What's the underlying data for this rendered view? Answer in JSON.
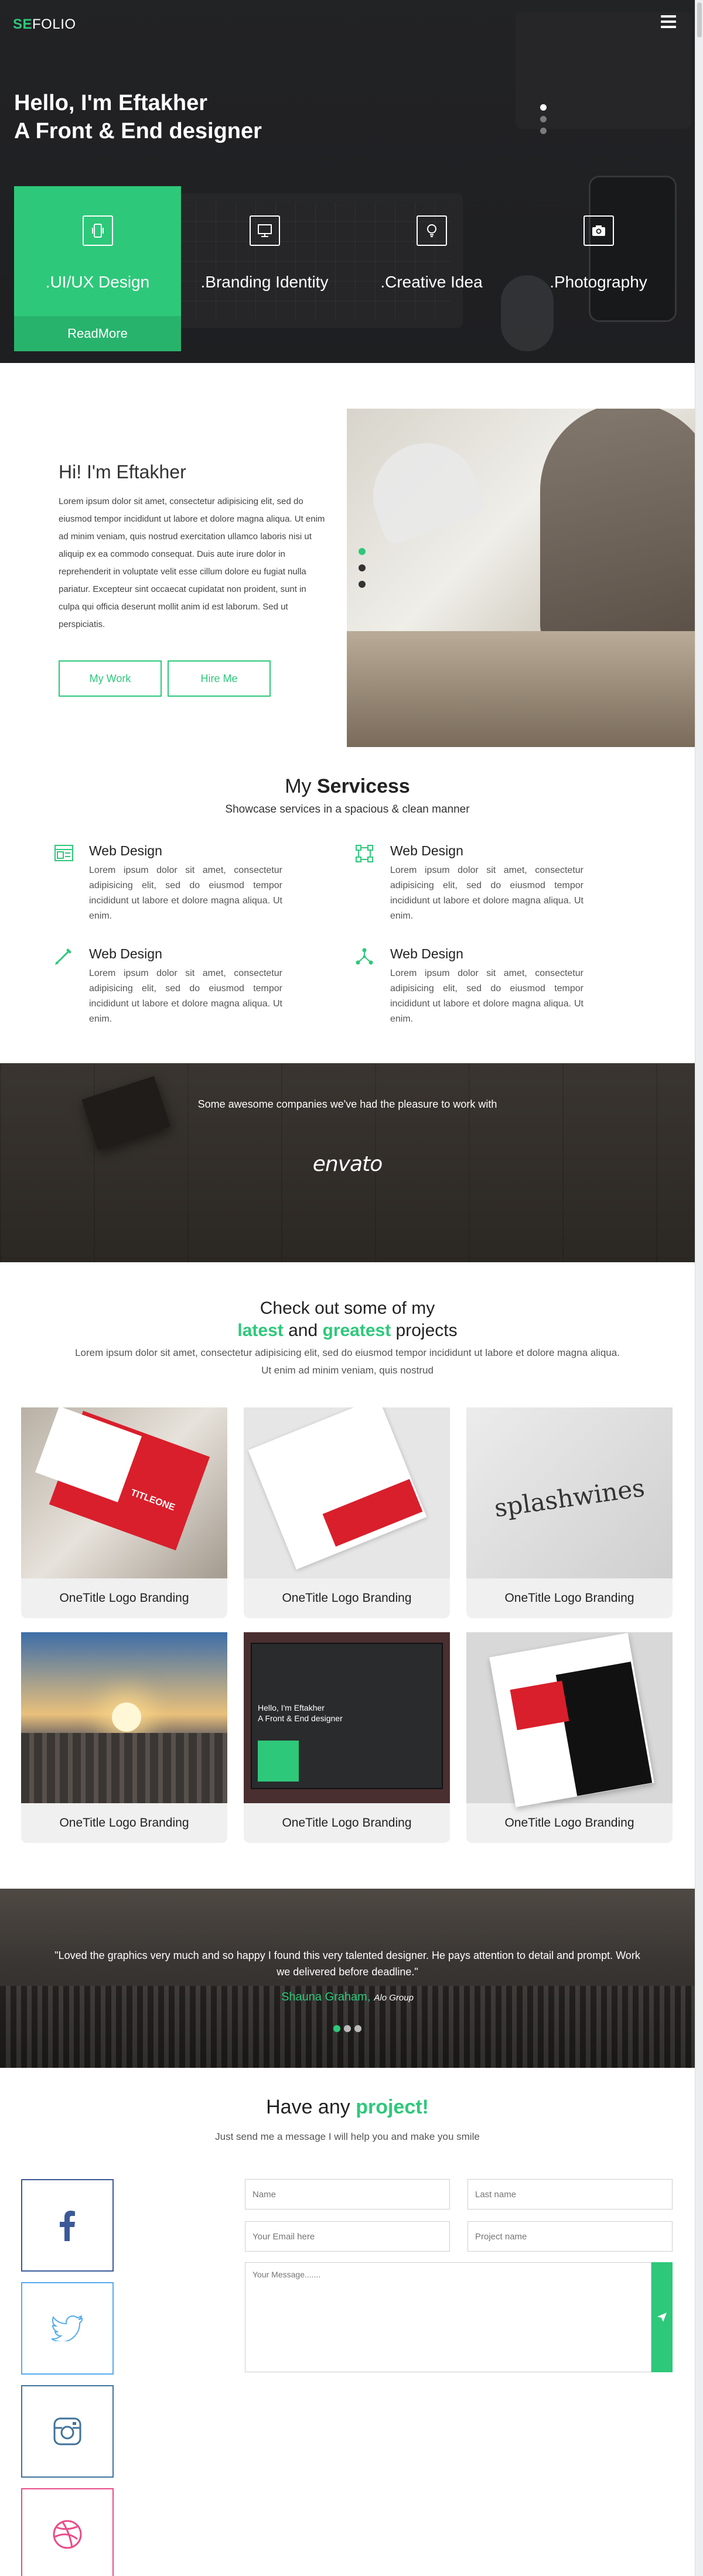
{
  "header": {
    "logo_accent": "SE",
    "logo_rest": "FOLIO"
  },
  "hero": {
    "line1_prefix": "Hello, I'm ",
    "line1_name": "Eftakher",
    "line2_prefix": "A ",
    "line2_bold": "Front & End",
    "line2_suffix": " designer",
    "service_cards": [
      {
        "icon": "mobile-icon",
        "label": ".UI/UX Design",
        "active": true
      },
      {
        "icon": "monitor-icon",
        "label": ".Branding Identity",
        "active": false
      },
      {
        "icon": "lightbulb-icon",
        "label": ".Creative Idea",
        "active": false
      },
      {
        "icon": "camera-icon",
        "label": ".Photography",
        "active": false
      }
    ],
    "read_more": "ReadMore",
    "slider_dots": 3,
    "active_dot": 0
  },
  "about": {
    "title": "Hi! I'm Eftakher",
    "body": "Lorem ipsum dolor sit amet, consectetur adipisicing elit, sed do eiusmod tempor incididunt ut labore et dolore magna aliqua. Ut enim ad minim veniam, quis nostrud exercitation ullamco laboris nisi ut aliquip ex ea commodo consequat. Duis aute irure dolor in reprehenderit in voluptate velit esse cillum dolore eu fugiat nulla pariatur. Excepteur sint occaecat cupidatat non proident, sunt in culpa qui officia deserunt mollit anim id est laborum. Sed ut perspiciatis.",
    "btn_work": "My Work",
    "btn_hire": "Hire Me"
  },
  "services": {
    "title_prefix": "My ",
    "title_bold": "Servicess",
    "subtitle": "Showcase services in a spacious & clean manner",
    "items": [
      {
        "icon": "layout-icon",
        "title": "Web Design",
        "text": "Lorem ipsum dolor sit amet, consectetur adipisicing elit, sed do eiusmod tempor incididunt ut labore et dolore magna aliqua. Ut enim."
      },
      {
        "icon": "vector-icon",
        "title": "Web Design",
        "text": "Lorem ipsum dolor sit amet, consectetur adipisicing elit, sed do eiusmod tempor incididunt ut labore et dolore magna aliqua. Ut enim."
      },
      {
        "icon": "pen-icon",
        "title": "Web Design",
        "text": "Lorem ipsum dolor sit amet, consectetur adipisicing elit, sed do eiusmod tempor incididunt ut labore et dolore magna aliqua. Ut enim."
      },
      {
        "icon": "nodes-icon",
        "title": "Web Design",
        "text": "Lorem ipsum dolor sit amet, consectetur adipisicing elit, sed do eiusmod tempor incididunt ut labore et dolore magna aliqua. Ut enim."
      }
    ]
  },
  "partners": {
    "label": "Some awesome companies we've had the pleasure to work with",
    "brand": "envato"
  },
  "projects": {
    "title_line1": "Check out some of my",
    "title_g1": "latest",
    "title_and": " and ",
    "title_g2": "greatest",
    "title_end": " projects",
    "description": "Lorem ipsum dolor sit amet, consectetur adipisicing elit, sed do eiusmod tempor incididunt ut labore et dolore magna aliqua. Ut enim ad minim veniam, quis nostrud",
    "cards": [
      {
        "caption": "OneTitle Logo Branding"
      },
      {
        "caption": "OneTitle Logo Branding"
      },
      {
        "caption": "OneTitle Logo Branding"
      },
      {
        "caption": "OneTitle Logo Branding"
      },
      {
        "caption": "OneTitle Logo Branding"
      },
      {
        "caption": "OneTitle Logo Branding"
      }
    ],
    "splash_word": "splashwines",
    "card1_brand": "TITLEONE",
    "card5_line1": "Hello, I'm Eftakher",
    "card5_line2": "A Front & End designer"
  },
  "testimonial": {
    "quote": "\"Loved the graphics very much and so happy I found this very talented designer. He pays attention to detail and prompt. Work we delivered before deadline.\"",
    "name": "Shauna Graham,",
    "company": "Alo Group",
    "dots": 3,
    "active_dot": 0
  },
  "contact": {
    "title_prefix": "Have any ",
    "title_accent": "project!",
    "subtitle": "Just send me a message I will help you and make you smile",
    "name_placeholder": "Name",
    "lastname_placeholder": "Last name",
    "email_placeholder": "Your Email here",
    "project_placeholder": "Project name",
    "message_placeholder": "Your Message.......",
    "social": [
      {
        "icon": "facebook-icon",
        "color": "#3b5998"
      },
      {
        "icon": "twitter-icon",
        "color": "#55acee"
      },
      {
        "icon": "instagram-icon",
        "color": "#3f729b"
      },
      {
        "icon": "dribbble-icon",
        "color": "#ea4c89"
      }
    ]
  },
  "colors": {
    "accent": "#2ec87a",
    "dark": "#2b2c2e"
  }
}
